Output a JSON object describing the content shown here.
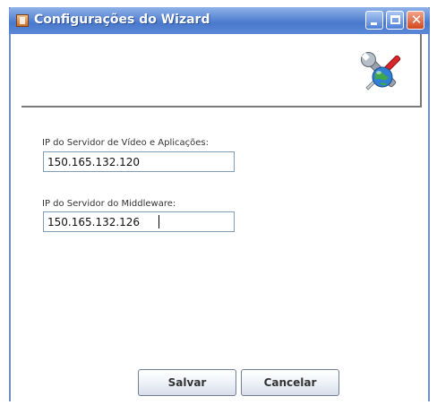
{
  "window": {
    "title": "Configurações do Wizard",
    "app_icon": "java-app-icon",
    "controls": {
      "minimize": "minimize-icon",
      "maximize": "maximize-icon",
      "close": "close-icon"
    }
  },
  "banner": {
    "icon": "wrench-screwdriver-globe-icon"
  },
  "form": {
    "video_server": {
      "label": "IP do Servidor de Vídeo e Aplicações:",
      "value": "150.165.132.120"
    },
    "middleware_server": {
      "label": "IP do Servidor do Middleware:",
      "value": "150.165.132.126"
    }
  },
  "buttons": {
    "save_label": "Salvar",
    "cancel_label": "Cancelar"
  },
  "colors": {
    "titlebar": "#4a78cc",
    "close_button": "#d2471f"
  }
}
